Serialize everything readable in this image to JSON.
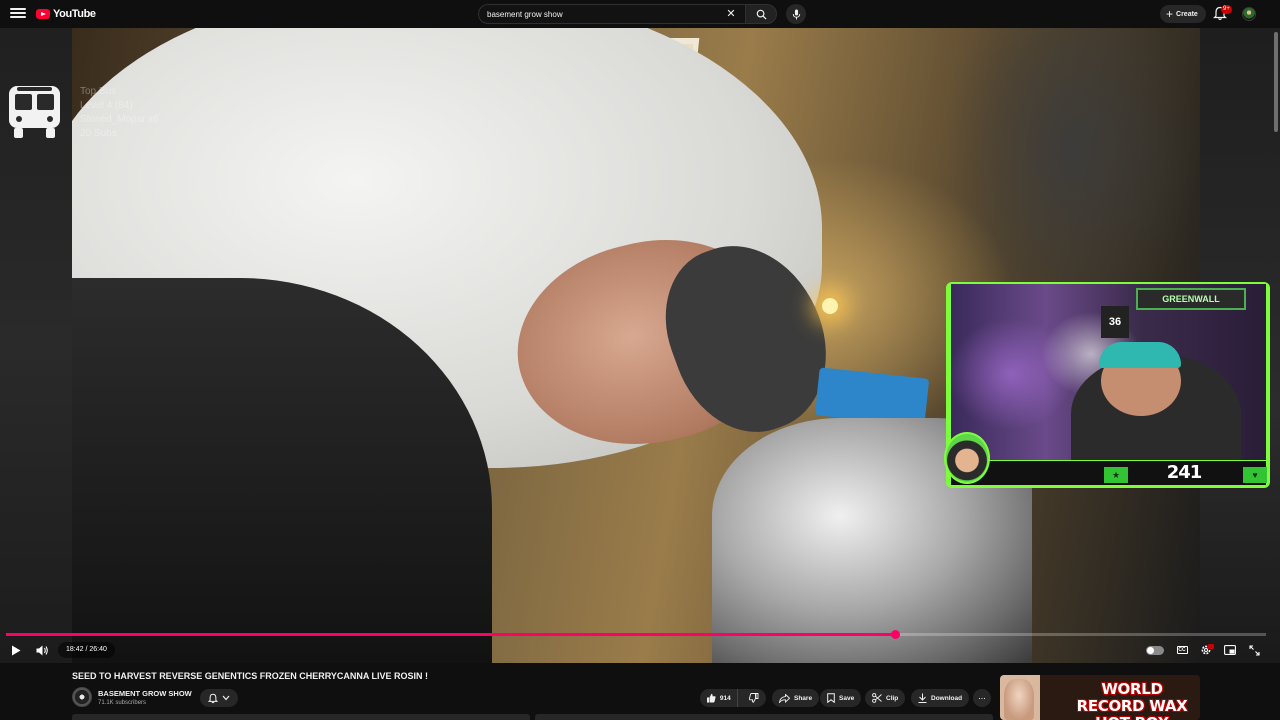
{
  "header": {
    "logo_text": "YouTube",
    "search": {
      "value": "basement grow show",
      "placeholder": "Search"
    },
    "create_label": "Create",
    "notification_count": "9+"
  },
  "player": {
    "overlay": {
      "lines": [
        "Top Bus",
        "Level 4 (84)",
        "Stoned_Mopar x6",
        "20 Subs"
      ]
    },
    "webcam": {
      "banner": "GREENWALL",
      "jersey": "36",
      "counter": "241"
    },
    "progress": {
      "played_fraction": 0.7053
    },
    "time": {
      "current": "18:42",
      "separator": " / ",
      "total": "26:40"
    },
    "accent_color": "#ff0066"
  },
  "video": {
    "title": "SEED TO HARVEST REVERSE GENENTICS FROZEN CHERRYCANNA LIVE ROSIN !",
    "channel": {
      "name": "BASEMENT GROW SHOW",
      "subscribers": "71.1K subscribers"
    },
    "actions": {
      "likes": "914",
      "share": "Share",
      "save": "Save",
      "clip": "Clip",
      "download": "Download",
      "more": "..."
    }
  },
  "recommended": {
    "thumb_text": "WORLD RECORD WAX HOT BOX"
  }
}
